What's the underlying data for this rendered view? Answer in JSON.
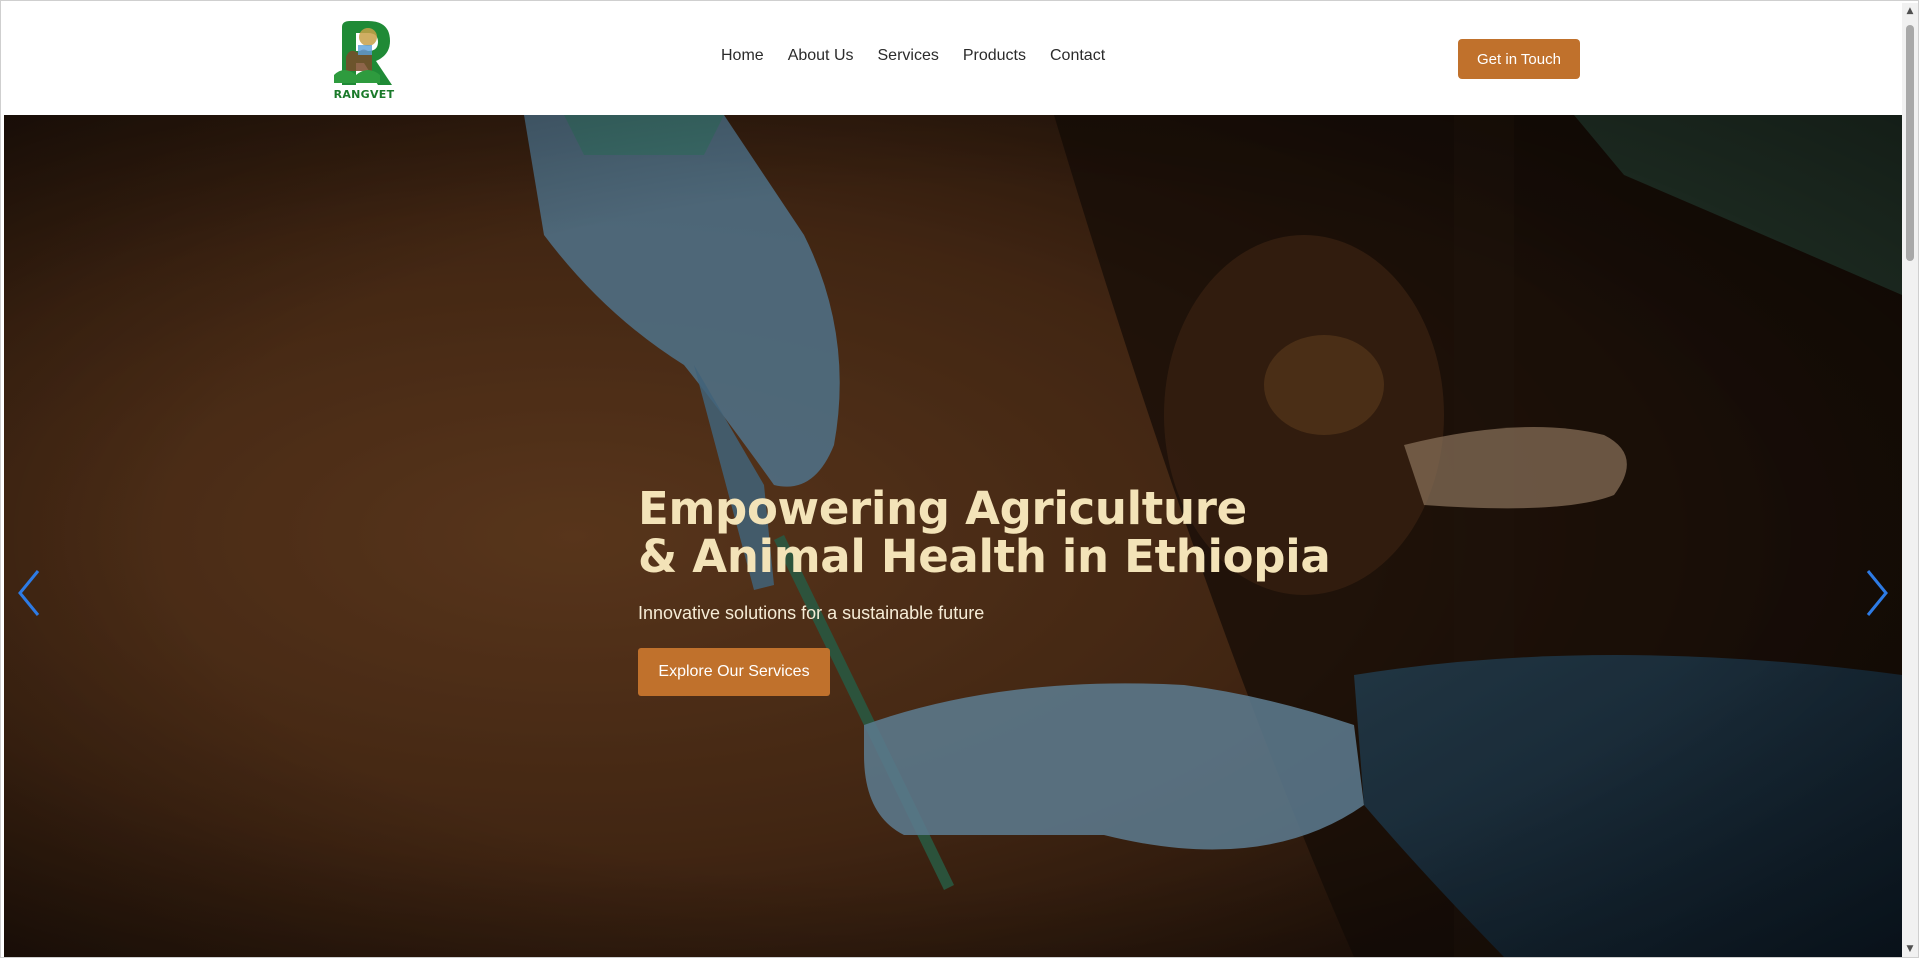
{
  "brand": {
    "logo_text": "RANGVET",
    "colors": {
      "accent": "#c0712c",
      "logo_green": "#1a7a2a",
      "hero_title": "#f3e3b8"
    }
  },
  "nav": {
    "items": [
      "Home",
      "About Us",
      "Services",
      "Products",
      "Contact"
    ],
    "cta_label": "Get in Touch"
  },
  "hero": {
    "title_line1": "Empowering Agriculture",
    "title_line2": "& Animal Health in Ethiopia",
    "subtitle": "Innovative solutions for a sustainable future",
    "button_label": "Explore Our Services",
    "prev_icon": "chevron-left-icon",
    "next_icon": "chevron-right-icon"
  }
}
